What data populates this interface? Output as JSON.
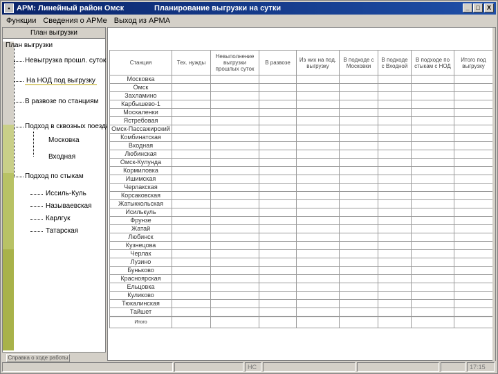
{
  "window": {
    "app_title": "АРМ: Линейный район Омск",
    "doc_title": "Планирование выгрузки на сутки",
    "controls": [
      "_",
      "□",
      "X"
    ]
  },
  "menu": [
    "Функции",
    "Сведения о АРМе",
    "Выход из АРМА"
  ],
  "left_panel": {
    "header": "План выгрузки",
    "tree": {
      "root": "План выгрузки",
      "items": [
        {
          "label": "Невыгрузка прошл. суток",
          "level": 1
        },
        {
          "label": "На НОД под выгрузку",
          "level": 1,
          "selected": true
        },
        {
          "label": "В развозе по станциям",
          "level": 1
        },
        {
          "label": "Подход в сквозных поездах",
          "level": 1
        },
        {
          "label": "Московка",
          "level": 2
        },
        {
          "label": "Входная",
          "level": 2
        },
        {
          "label": "Подход по стыкам",
          "level": 1
        },
        {
          "label": "Иссиль-Куль",
          "level": 2
        },
        {
          "label": "Называевская",
          "level": 2
        },
        {
          "label": "Карлгук",
          "level": 2
        },
        {
          "label": "Татарская",
          "level": 2
        }
      ]
    },
    "bottom_tab": "Справка о ходе работы"
  },
  "table": {
    "headers": [
      "Станция",
      "Тех. нужды",
      "Невыполнение выгрузки прошлых суток",
      "В развозе",
      "Из них на под. выгрузку",
      "В подходе с Московки",
      "В подходе с Входной",
      "В подходе по стыкам с НОД",
      "Итого под выгрузку"
    ],
    "stations": [
      "Московка",
      "Омск",
      "Захламино",
      "Карбышево-1",
      "Москаленки",
      "Ястребовая",
      "Омск-Пассажирский",
      "Комбинатская",
      "Входная",
      "Любинская",
      "Омск-Кулунда",
      "Кормиловка",
      "Ишимская",
      "Черлакская",
      "Корсаковская",
      "Жатыккольская",
      "Исилькуль",
      "Фрунзе",
      "Жатай",
      "Любинск",
      "Кузнецова",
      "Черлак",
      "Лузино",
      "Буньково",
      "Красноярская",
      "Ельцовка",
      "Куликово",
      "Тюкалинская",
      "Тайшет"
    ],
    "total_label": "Итого"
  },
  "status": {
    "cells": [
      "",
      "",
      "НС",
      "",
      "",
      "",
      "17:15"
    ]
  }
}
